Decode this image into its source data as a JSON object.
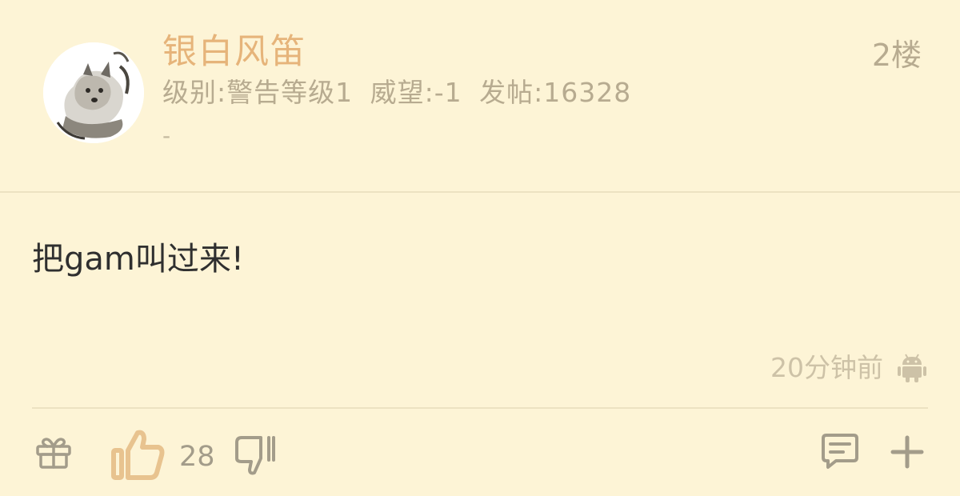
{
  "post": {
    "username": "银白风笛",
    "level": "级别:警告等级1",
    "reputation": "威望:-1",
    "posts": "发帖:16328",
    "signature": "-",
    "floor": "2楼",
    "content": "把gam叫过来!",
    "time": "20分钟前",
    "platform_icon": "android-icon"
  },
  "actions": {
    "like_count": "28",
    "icons": [
      "gift-icon",
      "thumbs-up-icon",
      "thumbs-down-icon",
      "comment-icon",
      "plus-icon"
    ]
  },
  "colors": {
    "background": "#fdf4d6",
    "username": "#e6b47a",
    "meta": "#b7ab90",
    "like_accent": "#e8c38f",
    "text": "#2f2f2f"
  }
}
